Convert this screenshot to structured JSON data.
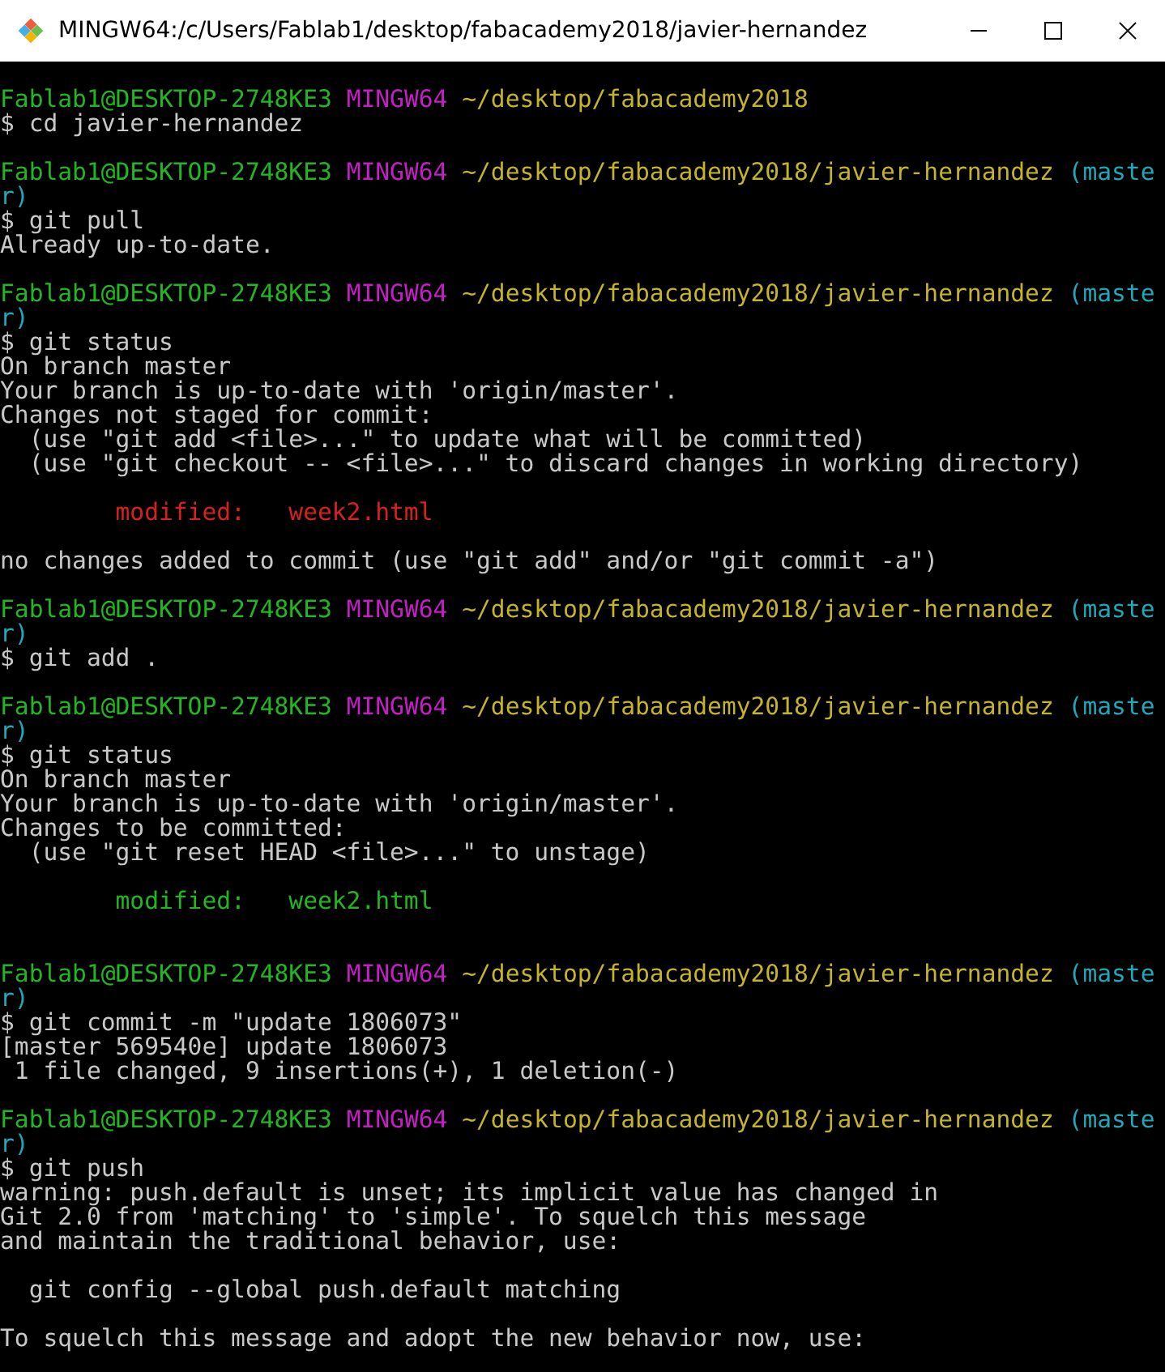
{
  "window": {
    "title": "MINGW64:/c/Users/Fablab1/desktop/fabacademy2018/javier-hernandez"
  },
  "terminal": {
    "lines": [
      {
        "kind": "blank"
      },
      {
        "kind": "text",
        "segments": [
          {
            "kind": "user",
            "text": "Fablab1@DESKTOP-2748KE3"
          },
          {
            "kind": "system",
            "text": "MINGW64"
          },
          {
            "kind": "path",
            "text": "~/desktop/fabacademy2018"
          }
        ]
      },
      {
        "kind": "text",
        "segments": [
          {
            "kind": "command",
            "text": "$ cd javier-hernandez"
          }
        ]
      },
      {
        "kind": "blank"
      },
      {
        "kind": "text",
        "segments": [
          {
            "kind": "user",
            "text": "Fablab1@DESKTOP-2748KE3"
          },
          {
            "kind": "system",
            "text": "MINGW64"
          },
          {
            "kind": "path",
            "text": "~/desktop/fabacademy2018/javier-hernandez"
          },
          {
            "kind": "branch",
            "text": "(maste"
          }
        ]
      },
      {
        "kind": "text",
        "segments": [
          {
            "kind": "branch",
            "text": "r)"
          }
        ]
      },
      {
        "kind": "text",
        "segments": [
          {
            "kind": "command",
            "text": "$ git pull"
          }
        ]
      },
      {
        "kind": "text",
        "segments": [
          {
            "kind": "output",
            "text": "Already up-to-date."
          }
        ]
      },
      {
        "kind": "blank"
      },
      {
        "kind": "text",
        "segments": [
          {
            "kind": "user",
            "text": "Fablab1@DESKTOP-2748KE3"
          },
          {
            "kind": "system",
            "text": "MINGW64"
          },
          {
            "kind": "path",
            "text": "~/desktop/fabacademy2018/javier-hernandez"
          },
          {
            "kind": "branch",
            "text": "(maste"
          }
        ]
      },
      {
        "kind": "text",
        "segments": [
          {
            "kind": "branch",
            "text": "r)"
          }
        ]
      },
      {
        "kind": "text",
        "segments": [
          {
            "kind": "command",
            "text": "$ git status"
          }
        ]
      },
      {
        "kind": "text",
        "segments": [
          {
            "kind": "output",
            "text": "On branch master"
          }
        ]
      },
      {
        "kind": "text",
        "segments": [
          {
            "kind": "output",
            "text": "Your branch is up-to-date with 'origin/master'."
          }
        ]
      },
      {
        "kind": "text",
        "segments": [
          {
            "kind": "output",
            "text": "Changes not staged for commit:"
          }
        ]
      },
      {
        "kind": "text",
        "segments": [
          {
            "kind": "output",
            "text": "  (use \"git add <file>...\" to update what will be committed)"
          }
        ]
      },
      {
        "kind": "text",
        "segments": [
          {
            "kind": "output",
            "text": "  (use \"git checkout -- <file>...\" to discard changes in working directory)"
          }
        ]
      },
      {
        "kind": "blank"
      },
      {
        "kind": "text",
        "segments": [
          {
            "kind": "unstaged",
            "text": "        modified:   week2.html"
          }
        ]
      },
      {
        "kind": "blank"
      },
      {
        "kind": "text",
        "segments": [
          {
            "kind": "output",
            "text": "no changes added to commit (use \"git add\" and/or \"git commit -a\")"
          }
        ]
      },
      {
        "kind": "blank"
      },
      {
        "kind": "text",
        "segments": [
          {
            "kind": "user",
            "text": "Fablab1@DESKTOP-2748KE3"
          },
          {
            "kind": "system",
            "text": "MINGW64"
          },
          {
            "kind": "path",
            "text": "~/desktop/fabacademy2018/javier-hernandez"
          },
          {
            "kind": "branch",
            "text": "(maste"
          }
        ]
      },
      {
        "kind": "text",
        "segments": [
          {
            "kind": "branch",
            "text": "r)"
          }
        ]
      },
      {
        "kind": "text",
        "segments": [
          {
            "kind": "command",
            "text": "$ git add ."
          }
        ]
      },
      {
        "kind": "blank"
      },
      {
        "kind": "text",
        "segments": [
          {
            "kind": "user",
            "text": "Fablab1@DESKTOP-2748KE3"
          },
          {
            "kind": "system",
            "text": "MINGW64"
          },
          {
            "kind": "path",
            "text": "~/desktop/fabacademy2018/javier-hernandez"
          },
          {
            "kind": "branch",
            "text": "(maste"
          }
        ]
      },
      {
        "kind": "text",
        "segments": [
          {
            "kind": "branch",
            "text": "r)"
          }
        ]
      },
      {
        "kind": "text",
        "segments": [
          {
            "kind": "command",
            "text": "$ git status"
          }
        ]
      },
      {
        "kind": "text",
        "segments": [
          {
            "kind": "output",
            "text": "On branch master"
          }
        ]
      },
      {
        "kind": "text",
        "segments": [
          {
            "kind": "output",
            "text": "Your branch is up-to-date with 'origin/master'."
          }
        ]
      },
      {
        "kind": "text",
        "segments": [
          {
            "kind": "output",
            "text": "Changes to be committed:"
          }
        ]
      },
      {
        "kind": "text",
        "segments": [
          {
            "kind": "output",
            "text": "  (use \"git reset HEAD <file>...\" to unstage)"
          }
        ]
      },
      {
        "kind": "blank"
      },
      {
        "kind": "text",
        "segments": [
          {
            "kind": "staged",
            "text": "        modified:   week2.html"
          }
        ]
      },
      {
        "kind": "blank"
      },
      {
        "kind": "blank"
      },
      {
        "kind": "text",
        "segments": [
          {
            "kind": "user",
            "text": "Fablab1@DESKTOP-2748KE3"
          },
          {
            "kind": "system",
            "text": "MINGW64"
          },
          {
            "kind": "path",
            "text": "~/desktop/fabacademy2018/javier-hernandez"
          },
          {
            "kind": "branch",
            "text": "(maste"
          }
        ]
      },
      {
        "kind": "text",
        "segments": [
          {
            "kind": "branch",
            "text": "r)"
          }
        ]
      },
      {
        "kind": "text",
        "segments": [
          {
            "kind": "command",
            "text": "$ git commit -m \"update 1806073\""
          }
        ]
      },
      {
        "kind": "text",
        "segments": [
          {
            "kind": "output",
            "text": "[master 569540e] update 1806073"
          }
        ]
      },
      {
        "kind": "text",
        "segments": [
          {
            "kind": "output",
            "text": " 1 file changed, 9 insertions(+), 1 deletion(-)"
          }
        ]
      },
      {
        "kind": "blank"
      },
      {
        "kind": "text",
        "segments": [
          {
            "kind": "user",
            "text": "Fablab1@DESKTOP-2748KE3"
          },
          {
            "kind": "system",
            "text": "MINGW64"
          },
          {
            "kind": "path",
            "text": "~/desktop/fabacademy2018/javier-hernandez"
          },
          {
            "kind": "branch",
            "text": "(maste"
          }
        ]
      },
      {
        "kind": "text",
        "segments": [
          {
            "kind": "branch",
            "text": "r)"
          }
        ]
      },
      {
        "kind": "text",
        "segments": [
          {
            "kind": "command",
            "text": "$ git push"
          }
        ]
      },
      {
        "kind": "text",
        "segments": [
          {
            "kind": "output",
            "text": "warning: push.default is unset; its implicit value has changed in"
          }
        ]
      },
      {
        "kind": "text",
        "segments": [
          {
            "kind": "output",
            "text": "Git 2.0 from 'matching' to 'simple'. To squelch this message"
          }
        ]
      },
      {
        "kind": "text",
        "segments": [
          {
            "kind": "output",
            "text": "and maintain the traditional behavior, use:"
          }
        ]
      },
      {
        "kind": "blank"
      },
      {
        "kind": "text",
        "segments": [
          {
            "kind": "output",
            "text": "  git config --global push.default matching"
          }
        ]
      },
      {
        "kind": "blank"
      },
      {
        "kind": "text",
        "segments": [
          {
            "kind": "output",
            "text": "To squelch this message and adopt the new behavior now, use:"
          }
        ]
      }
    ]
  }
}
